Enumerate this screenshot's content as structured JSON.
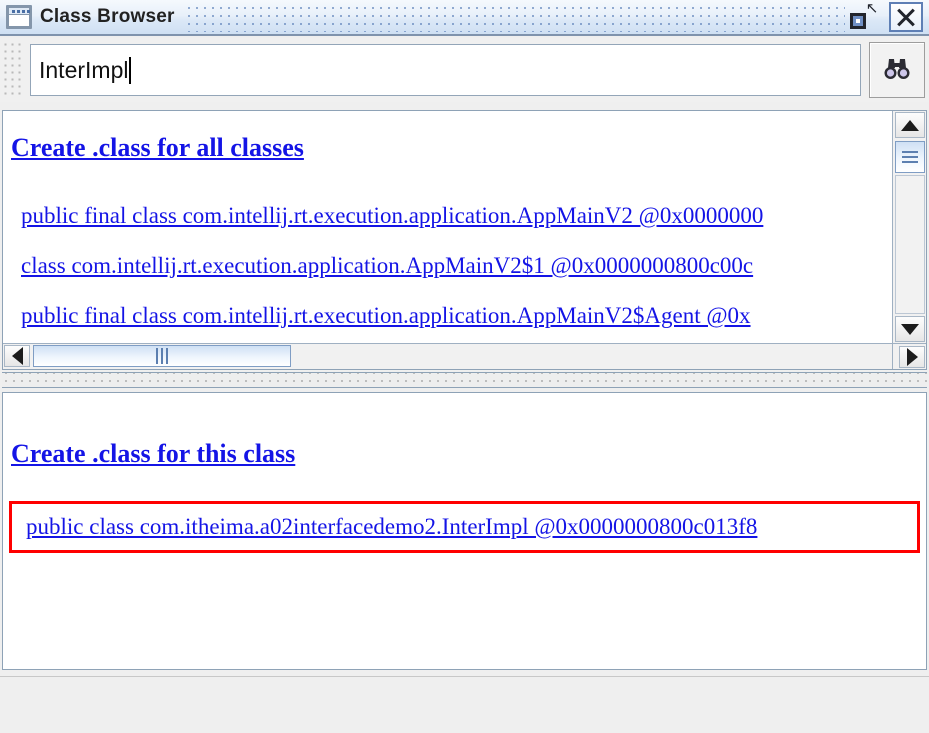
{
  "window": {
    "title": "Class Browser",
    "icon": "window-frame-icon",
    "restore_label": "Restore",
    "close_label": "Close"
  },
  "toolbar": {
    "search_value": "InterImpl",
    "search_placeholder": "",
    "search_button_icon": "binoculars-icon",
    "search_button_label": "Search"
  },
  "all_classes_panel": {
    "heading": "Create .class for all classes",
    "rows": [
      "public final class com.intellij.rt.execution.application.AppMainV2 @0x0000000",
      "class com.intellij.rt.execution.application.AppMainV2$1 @0x0000000800c00c",
      "public final class com.intellij.rt.execution.application.AppMainV2$Agent @0x"
    ],
    "scrollbar": {
      "up_arrow": "▲",
      "down_arrow": "▼",
      "left_arrow": "◀",
      "right_arrow": "▶"
    }
  },
  "this_class_panel": {
    "heading": "Create .class for this class",
    "selected_class": "public class com.itheima.a02interfacedemo2.InterImpl @0x0000000800c013f8",
    "highlight_color": "#ff0000"
  },
  "colors": {
    "link": "#1414e6",
    "titlebar_border": "#7f93ad",
    "panel_border": "#8ea2b6",
    "highlight": "#ff0000"
  }
}
